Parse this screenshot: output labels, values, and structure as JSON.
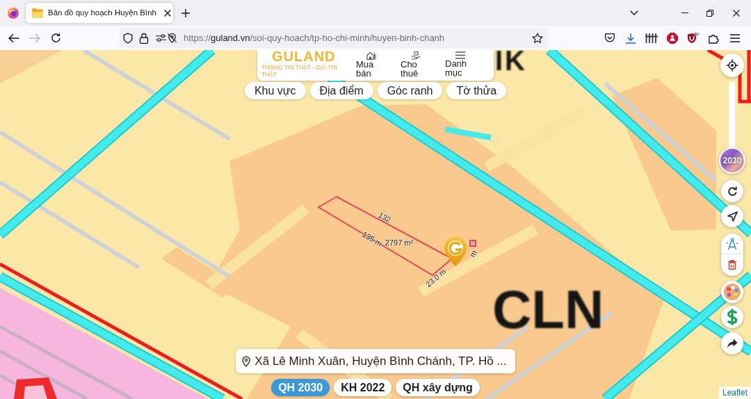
{
  "browser": {
    "tabs": [
      {
        "title": "Bản đồ quy hoạch Huyện Bình",
        "selected": true
      }
    ],
    "nav_buttons": [
      {
        "kind": "back",
        "disabled": false
      },
      {
        "kind": "forward",
        "disabled": true
      },
      {
        "kind": "reload",
        "disabled": false
      }
    ],
    "url": "https://**guland.vn**/soi-quy-hoach/tp-ho-chi-minh/huyen-binh-chanh"
  },
  "site_header": {
    "logo": "GULAND",
    "tagline": "THONG TIN THẬT - GIÁ TRỊ THẬT",
    "nav": [
      {
        "kind": "house",
        "label": "Mua bán"
      },
      {
        "kind": "hand",
        "label": "Cho thuê"
      },
      {
        "kind": "menu",
        "label": "Danh mục"
      }
    ]
  },
  "filters": [
    {
      "label": "Khu vực",
      "selected": false
    },
    {
      "label": "Địa điểm",
      "selected": false
    },
    {
      "label": "Góc ranh",
      "selected": false
    },
    {
      "label": "Tờ thửa",
      "selected": false
    }
  ],
  "map": {
    "land_use_labels": [
      "IK",
      "CLN"
    ],
    "parcel": {
      "top_edge": "132",
      "area": "2797 m²",
      "long_edge": "135 m",
      "short_edge": "23.0 m",
      "hidden_edge": "m"
    }
  },
  "opacity_slider": {
    "level": 0,
    "label": "2030"
  },
  "address": "Xã Lê Minh Xuân, Huyện Bình Chánh, TP. Hồ ...",
  "layers": [
    {
      "label": "QH 2030",
      "selected": true
    },
    {
      "label": "KH 2022",
      "selected": false
    },
    {
      "label": "QH xây dựng",
      "selected": false
    }
  ],
  "attribution": "Leaflet"
}
